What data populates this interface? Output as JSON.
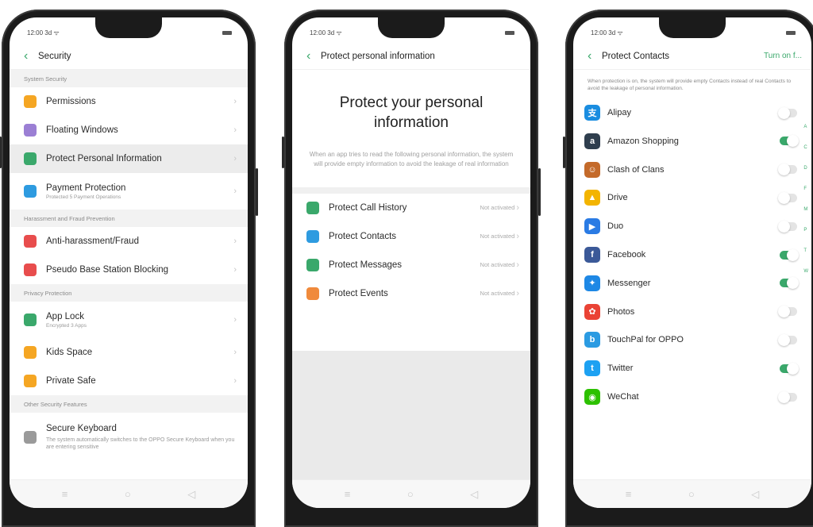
{
  "colors": {
    "accent": "#3aa86b",
    "on_toggle": "#3aa86b",
    "off_toggle": "#e4e4e4"
  },
  "screen1": {
    "status_time": "12:00 3d ᯤ",
    "title": "Security",
    "sections": [
      {
        "header": "System Security",
        "items": [
          {
            "label": "Permissions",
            "sub": "",
            "icon": "shield-icon",
            "color": "#f5a623"
          },
          {
            "label": "Floating Windows",
            "sub": "",
            "icon": "window-icon",
            "color": "#9b7fd4"
          },
          {
            "label": "Protect Personal Information",
            "sub": "",
            "icon": "lock-icon",
            "color": "#3aa86b",
            "highlighted": true
          },
          {
            "label": "Payment Protection",
            "sub": "Protected 5 Payment Operations",
            "icon": "shield-check-icon",
            "color": "#2e9be0"
          }
        ]
      },
      {
        "header": "Harassment and Fraud Prevention",
        "items": [
          {
            "label": "Anti-harassment/Fraud",
            "sub": "",
            "icon": "block-icon",
            "color": "#e84d4d"
          },
          {
            "label": "Pseudo Base Station Blocking",
            "sub": "",
            "icon": "antenna-icon",
            "color": "#e84d4d"
          }
        ]
      },
      {
        "header": "Privacy Protection",
        "items": [
          {
            "label": "App Lock",
            "sub": "Encrypted 3 Apps",
            "icon": "padlock-icon",
            "color": "#3aa86b"
          },
          {
            "label": "Kids Space",
            "sub": "",
            "icon": "kid-icon",
            "color": "#f5a623"
          },
          {
            "label": "Private Safe",
            "sub": "",
            "icon": "folder-icon",
            "color": "#f5a623"
          }
        ]
      },
      {
        "header": "Other Security Features",
        "items": [
          {
            "label": "Secure Keyboard",
            "sub": "",
            "icon": "keyboard-icon",
            "color": "#9a9a9a",
            "desc": "The system automatically switches to the OPPO Secure Keyboard when you are entering sensitive"
          }
        ]
      }
    ]
  },
  "screen2": {
    "status_time": "12:00 3d ᯤ",
    "title": "Protect personal information",
    "hero_title": "Protect your personal information",
    "hero_text": "When an app tries to read the following personal information, the system will provide empty information to avoid the leakage of real information",
    "items": [
      {
        "label": "Protect Call History",
        "status": "Not activated",
        "icon": "phone-icon",
        "color": "#3aa86b"
      },
      {
        "label": "Protect Contacts",
        "status": "Not activated",
        "icon": "person-icon",
        "color": "#2e9be0"
      },
      {
        "label": "Protect Messages",
        "status": "Not activated",
        "icon": "message-icon",
        "color": "#3aa86b"
      },
      {
        "label": "Protect Events",
        "status": "Not activated",
        "icon": "calendar-icon",
        "color": "#f08a3c"
      }
    ]
  },
  "screen3": {
    "status_time": "12:00 3d ᯤ",
    "title": "Protect Contacts",
    "action": "Turn on f...",
    "note": "When protection is on, the system will provide empty Contacts instead of real Contacts to avoid the leakage of personal information.",
    "apps": [
      {
        "name": "Alipay",
        "on": false,
        "icon": "alipay-icon",
        "color": "#1a8de0",
        "glyph": "支"
      },
      {
        "name": "Amazon Shopping",
        "on": true,
        "icon": "amazon-icon",
        "color": "#2f3e4e",
        "glyph": "a"
      },
      {
        "name": "Clash of Clans",
        "on": false,
        "icon": "clash-icon",
        "color": "#c46a2a",
        "glyph": "☺"
      },
      {
        "name": "Drive",
        "on": false,
        "icon": "drive-icon",
        "color": "#f3b400",
        "glyph": "▲"
      },
      {
        "name": "Duo",
        "on": false,
        "icon": "duo-icon",
        "color": "#2a7be4",
        "glyph": "▶"
      },
      {
        "name": "Facebook",
        "on": true,
        "icon": "facebook-icon",
        "color": "#3b5998",
        "glyph": "f"
      },
      {
        "name": "Messenger",
        "on": true,
        "icon": "messenger-icon",
        "color": "#1e88e5",
        "glyph": "✦"
      },
      {
        "name": "Photos",
        "on": false,
        "icon": "photos-icon",
        "color": "#ea4335",
        "glyph": "✿"
      },
      {
        "name": "TouchPal for OPPO",
        "on": false,
        "icon": "touchpal-icon",
        "color": "#2b9be2",
        "glyph": "b"
      },
      {
        "name": "Twitter",
        "on": true,
        "icon": "twitter-icon",
        "color": "#1da1f2",
        "glyph": "t"
      },
      {
        "name": "WeChat",
        "on": false,
        "icon": "wechat-icon",
        "color": "#2dc100",
        "glyph": "◉"
      }
    ],
    "alpha_index": [
      "A",
      "C",
      "D",
      "F",
      "M",
      "P",
      "T",
      "W"
    ]
  },
  "navbar": {
    "menu": "≡",
    "home": "○",
    "back": "◁"
  }
}
